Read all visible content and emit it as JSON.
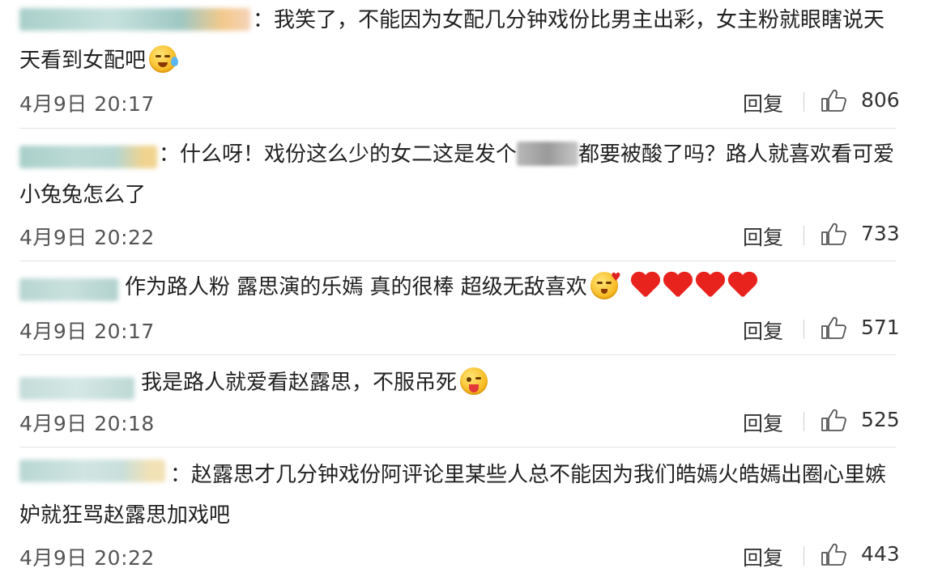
{
  "reply_label": "回复",
  "comments": [
    {
      "text": "：我笑了，不能因为女配几分钟戏份比男主出彩，女主粉就眼瞎说天天看到女配吧",
      "emoji": "sweat-face-icon",
      "date": "4月9日 20:17",
      "likes": "806"
    },
    {
      "text_before": "：什么呀！戏份这么少的女二这是发个",
      "text_after": "都要被酸了吗？路人就喜欢看可爱小兔兔怎么了",
      "date": "4月9日 20:22",
      "likes": "733"
    },
    {
      "text": "作为路人粉 露思演的乐嫣 真的很棒  超级无敌喜欢",
      "emoji": "kissing-face-icon",
      "hearts": 4,
      "date": "4月9日 20:17",
      "likes": "571"
    },
    {
      "text": "我是路人就爱看赵露思，不服吊死",
      "emoji": "tongue-face-icon",
      "date": "4月9日 20:18",
      "likes": "525"
    },
    {
      "text": "：赵露思才几分钟戏份阿评论里某些人总不能因为我们皓嫣火皓嫣出圈心里嫉妒就狂骂赵露思加戏吧",
      "date": "4月9日 20:22",
      "likes": "443"
    }
  ]
}
